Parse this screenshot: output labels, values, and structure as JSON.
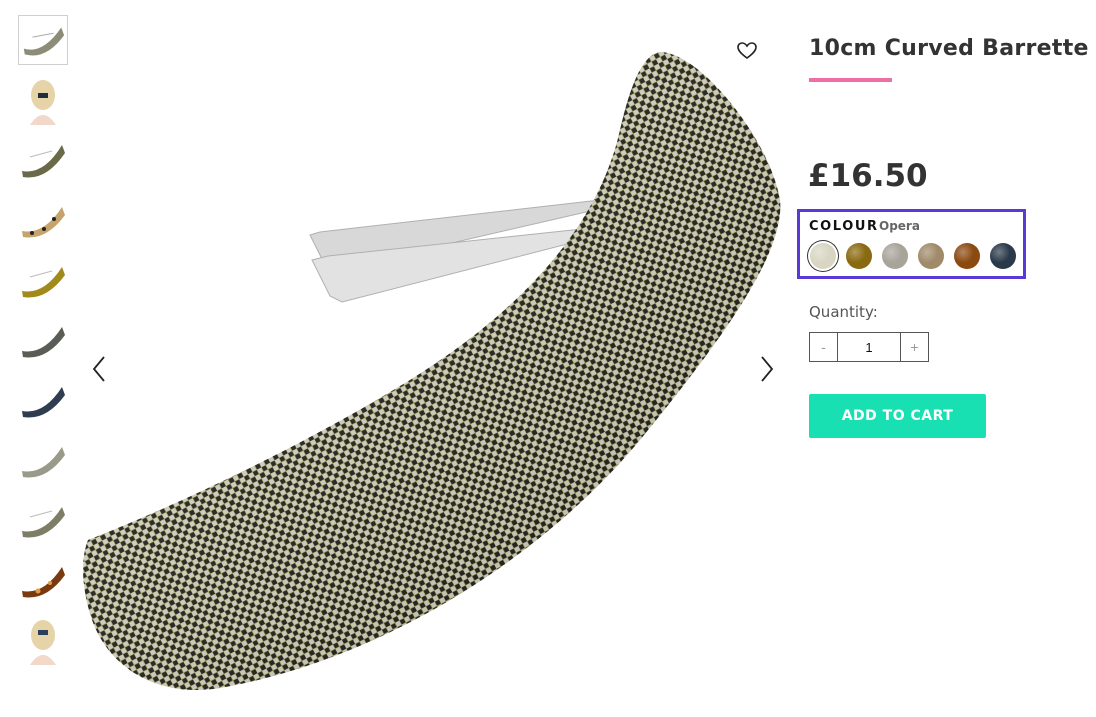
{
  "product": {
    "title": "10cm Curved Barrette",
    "price": "£16.50",
    "accent_color": "#ee6fa8"
  },
  "colour": {
    "label": "COLOUR",
    "selected": "Opera",
    "swatches": [
      {
        "name": "opera",
        "color": "#d8d6c2",
        "selected": true
      },
      {
        "name": "yellow-tortoise",
        "color": "#8a6a10"
      },
      {
        "name": "grey-marble",
        "color": "#a8a49a"
      },
      {
        "name": "leopard",
        "color": "#a08a6a"
      },
      {
        "name": "tortoiseshell",
        "color": "#8a4a10"
      },
      {
        "name": "navy",
        "color": "#2a3a4a"
      }
    ]
  },
  "quantity": {
    "label": "Quantity:",
    "value": "1",
    "minus": "-",
    "plus": "+"
  },
  "cart": {
    "button_label": "ADD TO CART",
    "button_color": "#19e0b3"
  },
  "gallery": {
    "thumbnails": [
      "opera-barrette",
      "model-back-navy",
      "opera-barrette-side",
      "leopard-barrette",
      "yellow-tortoise-barrette",
      "grey-barrette",
      "navy-barrette",
      "marble-barrette",
      "opera-barrette-alt",
      "tortoiseshell-barrette",
      "model-back-blue"
    ],
    "icons": {
      "prev": "chevron-left-icon",
      "next": "chevron-right-icon",
      "wishlist": "heart-icon"
    }
  }
}
